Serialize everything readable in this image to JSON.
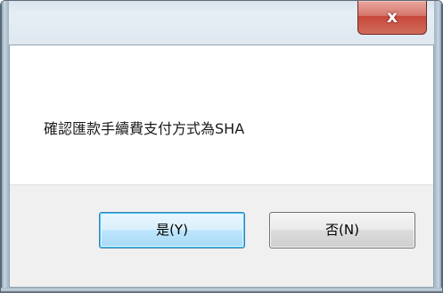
{
  "dialog": {
    "title": "",
    "close_glyph": "x",
    "message": "確認匯款手續費支付方式為SHA",
    "buttons": {
      "yes_label": "是(Y)",
      "no_label": "否(N)"
    }
  },
  "colors": {
    "default_button_border": "#3c7fb1",
    "close_button_red": "#c7473a"
  }
}
